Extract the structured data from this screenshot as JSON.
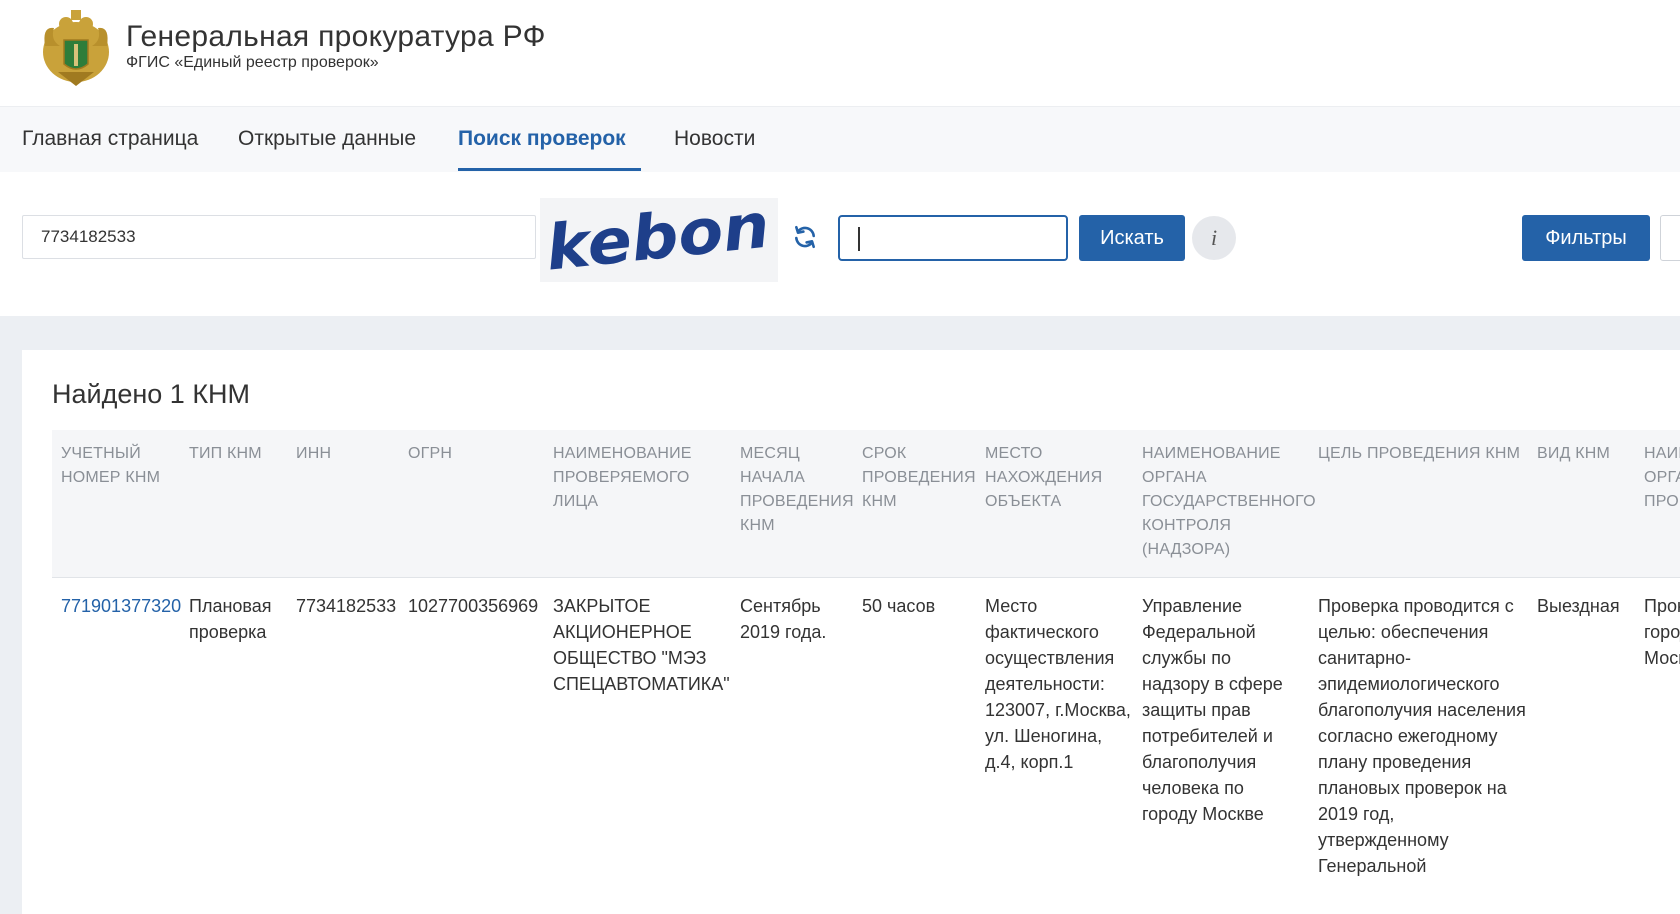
{
  "header": {
    "title": "Генеральная прокуратура РФ",
    "subtitle": "ФГИС «Единый реестр проверок»",
    "emblem_icon": "eagle-emblem-icon"
  },
  "nav": {
    "items": [
      {
        "label": "Главная страница",
        "active": false
      },
      {
        "label": "Открытые данные",
        "active": false
      },
      {
        "label": "Поиск проверок",
        "active": true
      },
      {
        "label": "Новости",
        "active": false
      }
    ]
  },
  "search": {
    "query_value": "7734182533",
    "captcha_text": "kebon",
    "captcha_value": "",
    "search_button": "Искать",
    "info_button": "i",
    "filters_button": "Фильтры",
    "refresh_icon": "refresh-icon"
  },
  "results": {
    "found_text": "Найдено 1 КНМ",
    "columns": [
      "Учетный номер КНМ",
      "Тип КНМ",
      "ИНН",
      "ОГРН",
      "Наименование проверяемого лица",
      "Месяц начала проведения КНМ",
      "Срок проведения КНМ",
      "Место нахождения объекта",
      "Наименование органа государственного контроля (надзора)",
      "Цель проведения КНМ",
      "Вид КНМ",
      "Наименование органа прокуратуры"
    ],
    "rows": [
      {
        "number": "771901377320",
        "type": "Плановая проверка",
        "inn": "7734182533",
        "ogrn": "1027700356969",
        "name": "ЗАКРЫТОЕ АКЦИОНЕРНОЕ ОБЩЕСТВО \"МЭЗ СПЕЦАВТОМАТИКА\"",
        "month": "Сентябрь 2019 года.",
        "duration": "50 часов",
        "location": "Место фактического осуществления деятельности: 123007, г.Москва, ул. Шеногина, д.4, корп.1",
        "authority": "Управление Федеральной службы по надзору в сфере защиты прав потребителей и благополучия человека по городу Москве",
        "purpose": "Проверка проводится с целью: обеспечения санитарно-эпидемиологического благополучия населения согласно ежегодному плану проведения плановых проверок на 2019 год, утвержденному Генеральной",
        "kind": "Выездная",
        "prosecutor": "Прокуратура города Москвы"
      }
    ]
  },
  "colors": {
    "accent": "#2462a8",
    "text": "#333333",
    "header_muted": "#8a8f96",
    "page_bg": "#eceff3"
  }
}
